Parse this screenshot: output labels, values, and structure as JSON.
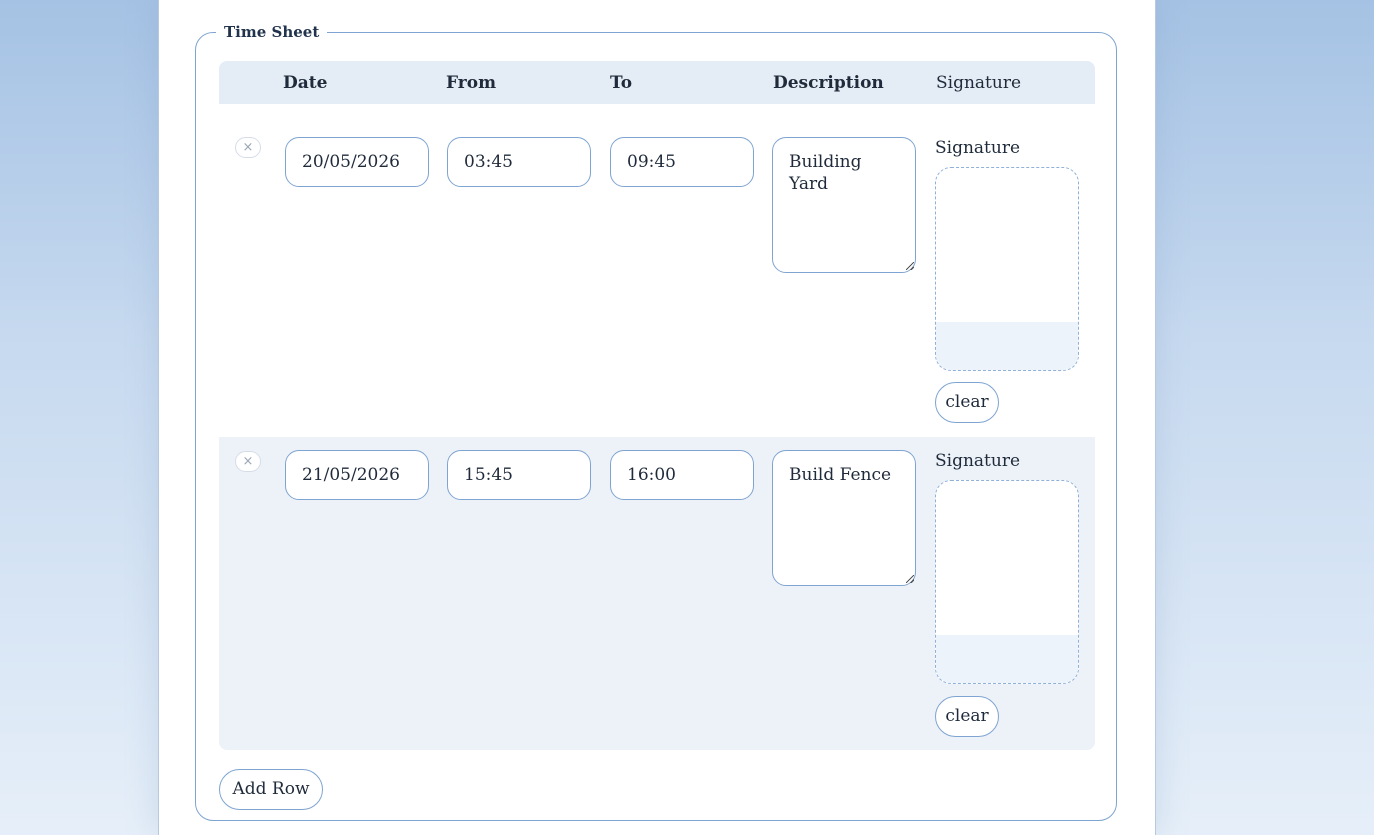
{
  "timesheet": {
    "legend": "Time Sheet",
    "headers": {
      "date": "Date",
      "from": "From",
      "to": "To",
      "description": "Description",
      "signature": "Signature"
    },
    "rows": [
      {
        "date": "20/05/2026",
        "from": "03:45",
        "to": "09:45",
        "description": "Building Yard",
        "signature_label": "Signature",
        "clear_label": "clear",
        "remove_icon": "×"
      },
      {
        "date": "21/05/2026",
        "from": "15:45",
        "to": "16:00",
        "description": "Build Fence",
        "signature_label": "Signature",
        "clear_label": "clear",
        "remove_icon": "×"
      }
    ],
    "add_row_label": "Add Row"
  },
  "colors": {
    "accent_border": "#7fa4d1",
    "header_bg": "#e4ecf5",
    "alt_row_bg": "#edf2f8"
  }
}
